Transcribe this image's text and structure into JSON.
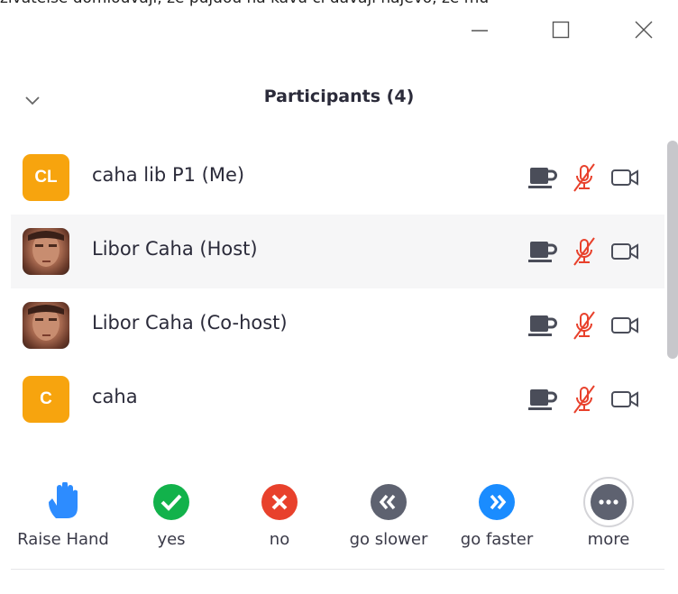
{
  "top_cut_text": "zivatelsé domlouvají, že pujdou na kávu či dávají najevo, že mu",
  "window_controls": {
    "minimize": "minimize-icon",
    "maximize": "maximize-icon",
    "close": "close-icon"
  },
  "panel": {
    "title": "Participants (4)",
    "collapse_icon": "chevron-down-icon"
  },
  "participants": [
    {
      "initials": "CL",
      "name": "caha lib P1 (Me)",
      "avatar": "initials",
      "highlighted": false
    },
    {
      "initials": "",
      "name": "Libor Caha (Host)",
      "avatar": "photo",
      "highlighted": true
    },
    {
      "initials": "",
      "name": "Libor Caha (Co-host)",
      "avatar": "photo",
      "highlighted": false
    },
    {
      "initials": "C",
      "name": "caha",
      "avatar": "initials",
      "highlighted": false
    }
  ],
  "status_icons": [
    "coffee-icon",
    "muted-microphone-icon",
    "video-camera-icon"
  ],
  "reactions": [
    {
      "label": "Raise Hand",
      "icon": "raise-hand-icon",
      "color": "#2d8cff"
    },
    {
      "label": "yes",
      "icon": "check-icon",
      "color": "#12b24b"
    },
    {
      "label": "no",
      "icon": "x-icon",
      "color": "#e8412c"
    },
    {
      "label": "go slower",
      "icon": "rewind-icon",
      "color": "#5e6270"
    },
    {
      "label": "go faster",
      "icon": "fast-forward-icon",
      "color": "#1a8cff"
    },
    {
      "label": "more",
      "icon": "more-icon",
      "color": "#5e6270"
    }
  ],
  "colors": {
    "accent_orange": "#f7a40e",
    "muted_red": "#e8412c",
    "icon_gray": "#5e6270"
  }
}
